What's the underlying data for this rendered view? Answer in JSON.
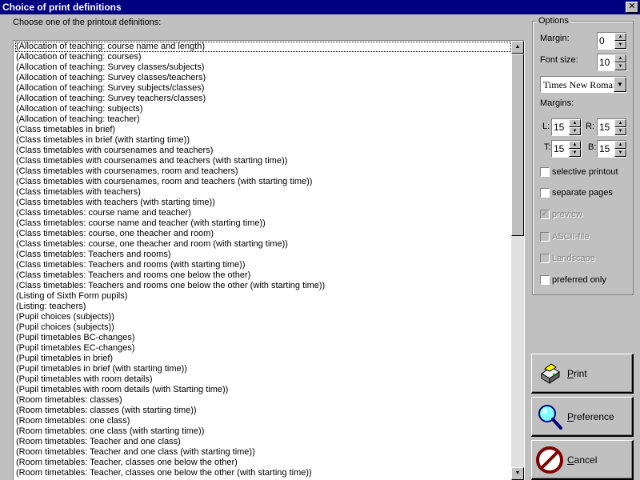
{
  "window": {
    "title": "Choice of print definitions",
    "close_glyph": "✕"
  },
  "prompt": "Choose one of the printout definitions:",
  "list": {
    "items": [
      "(Allocation of teaching: course name and length)",
      "(Allocation of teaching: courses)",
      "(Allocation of teaching: Survey classes/subjects)",
      "(Allocation of teaching: Survey classes/teachers)",
      "(Allocation of teaching: Survey subjects/classes)",
      "(Allocation of teaching: Survey teachers/classes)",
      "(Allocation of teaching: subjects)",
      "(Allocation of teaching: teacher)",
      "(Class timetables in brief)",
      "(Class timetables in brief (with starting time))",
      "(Class timetables with coursenames and teachers)",
      "(Class timetables with coursenames and teachers (with starting time))",
      "(Class timetables with coursenames, room and teachers)",
      "(Class timetables with coursenames, room and teachers (with starting time))",
      "(Class timetables with teachers)",
      "(Class timetables with teachers (with starting time))",
      "(Class timetables: course name and teacher)",
      "(Class timetables: course name and teacher (with starting time))",
      "(Class timetables: course, one theacher and room)",
      "(Class timetables: course, one theacher and room (with starting time))",
      "(Class timetables: Teachers and rooms)",
      "(Class timetables: Teachers and rooms (with starting time))",
      "(Class timetables: Teachers and rooms one below the other)",
      "(Class timetables: Teachers and rooms one below the other (with starting time))",
      "(Listing of Sixth Form pupils)",
      "(Listing: teachers)",
      "(Pupil choices (subjects))",
      "(Pupil choices (subjects))",
      "(Pupil timetables BC-changes)",
      "(Pupil timetables EC-changes)",
      "(Pupil timetables in brief)",
      "(Pupil timetables in brief (with starting time))",
      "(Pupil timetables with room details)",
      "(Pupil timetables with room details (with Starting time))",
      "(Room timetables: classes)",
      "(Room timetables: classes (with starting time))",
      "(Room timetables: one class)",
      "(Room timetables: one class (with starting time))",
      "(Room timetables: Teacher and one class)",
      "(Room timetables: Teacher and one class (with starting time))",
      "(Room timetables: Teacher, classes one below the other)",
      "(Room timetables: Teacher, classes one below the other (with starting time))"
    ],
    "scroll_up_glyph": "▲",
    "scroll_down_glyph": "▼"
  },
  "options": {
    "title": "Options",
    "margin_label": "Margin:",
    "margin_value": "0",
    "font_size_label": "Font size:",
    "font_size_value": "10",
    "font_value": "Times New Roman",
    "margins_label": "Margins:",
    "left_label": "L:",
    "left_value": "15",
    "right_label": "R:",
    "right_value": "15",
    "top_label": "T:",
    "top_value": "15",
    "bottom_label": "B:",
    "bottom_value": "15",
    "spin_up_glyph": "▲",
    "spin_down_glyph": "▼",
    "combo_glyph": "▼",
    "checkboxes": {
      "selective_printout": "selective printout",
      "separate_pages": "separate pages",
      "preview": "preview",
      "ascii_file": "ASCII-file",
      "landscape": "Landscape",
      "preferred_only": "preferred only"
    },
    "checkmark_glyph": "✓"
  },
  "buttons": {
    "print": {
      "accel": "P",
      "rest": "rint"
    },
    "preference": {
      "accel": "P",
      "rest": "reference"
    },
    "cancel": {
      "accel": "C",
      "rest": "ancel"
    }
  },
  "icons": {
    "print": "printer-icon",
    "preference": "magnifier-icon",
    "cancel": "no-entry-icon"
  }
}
